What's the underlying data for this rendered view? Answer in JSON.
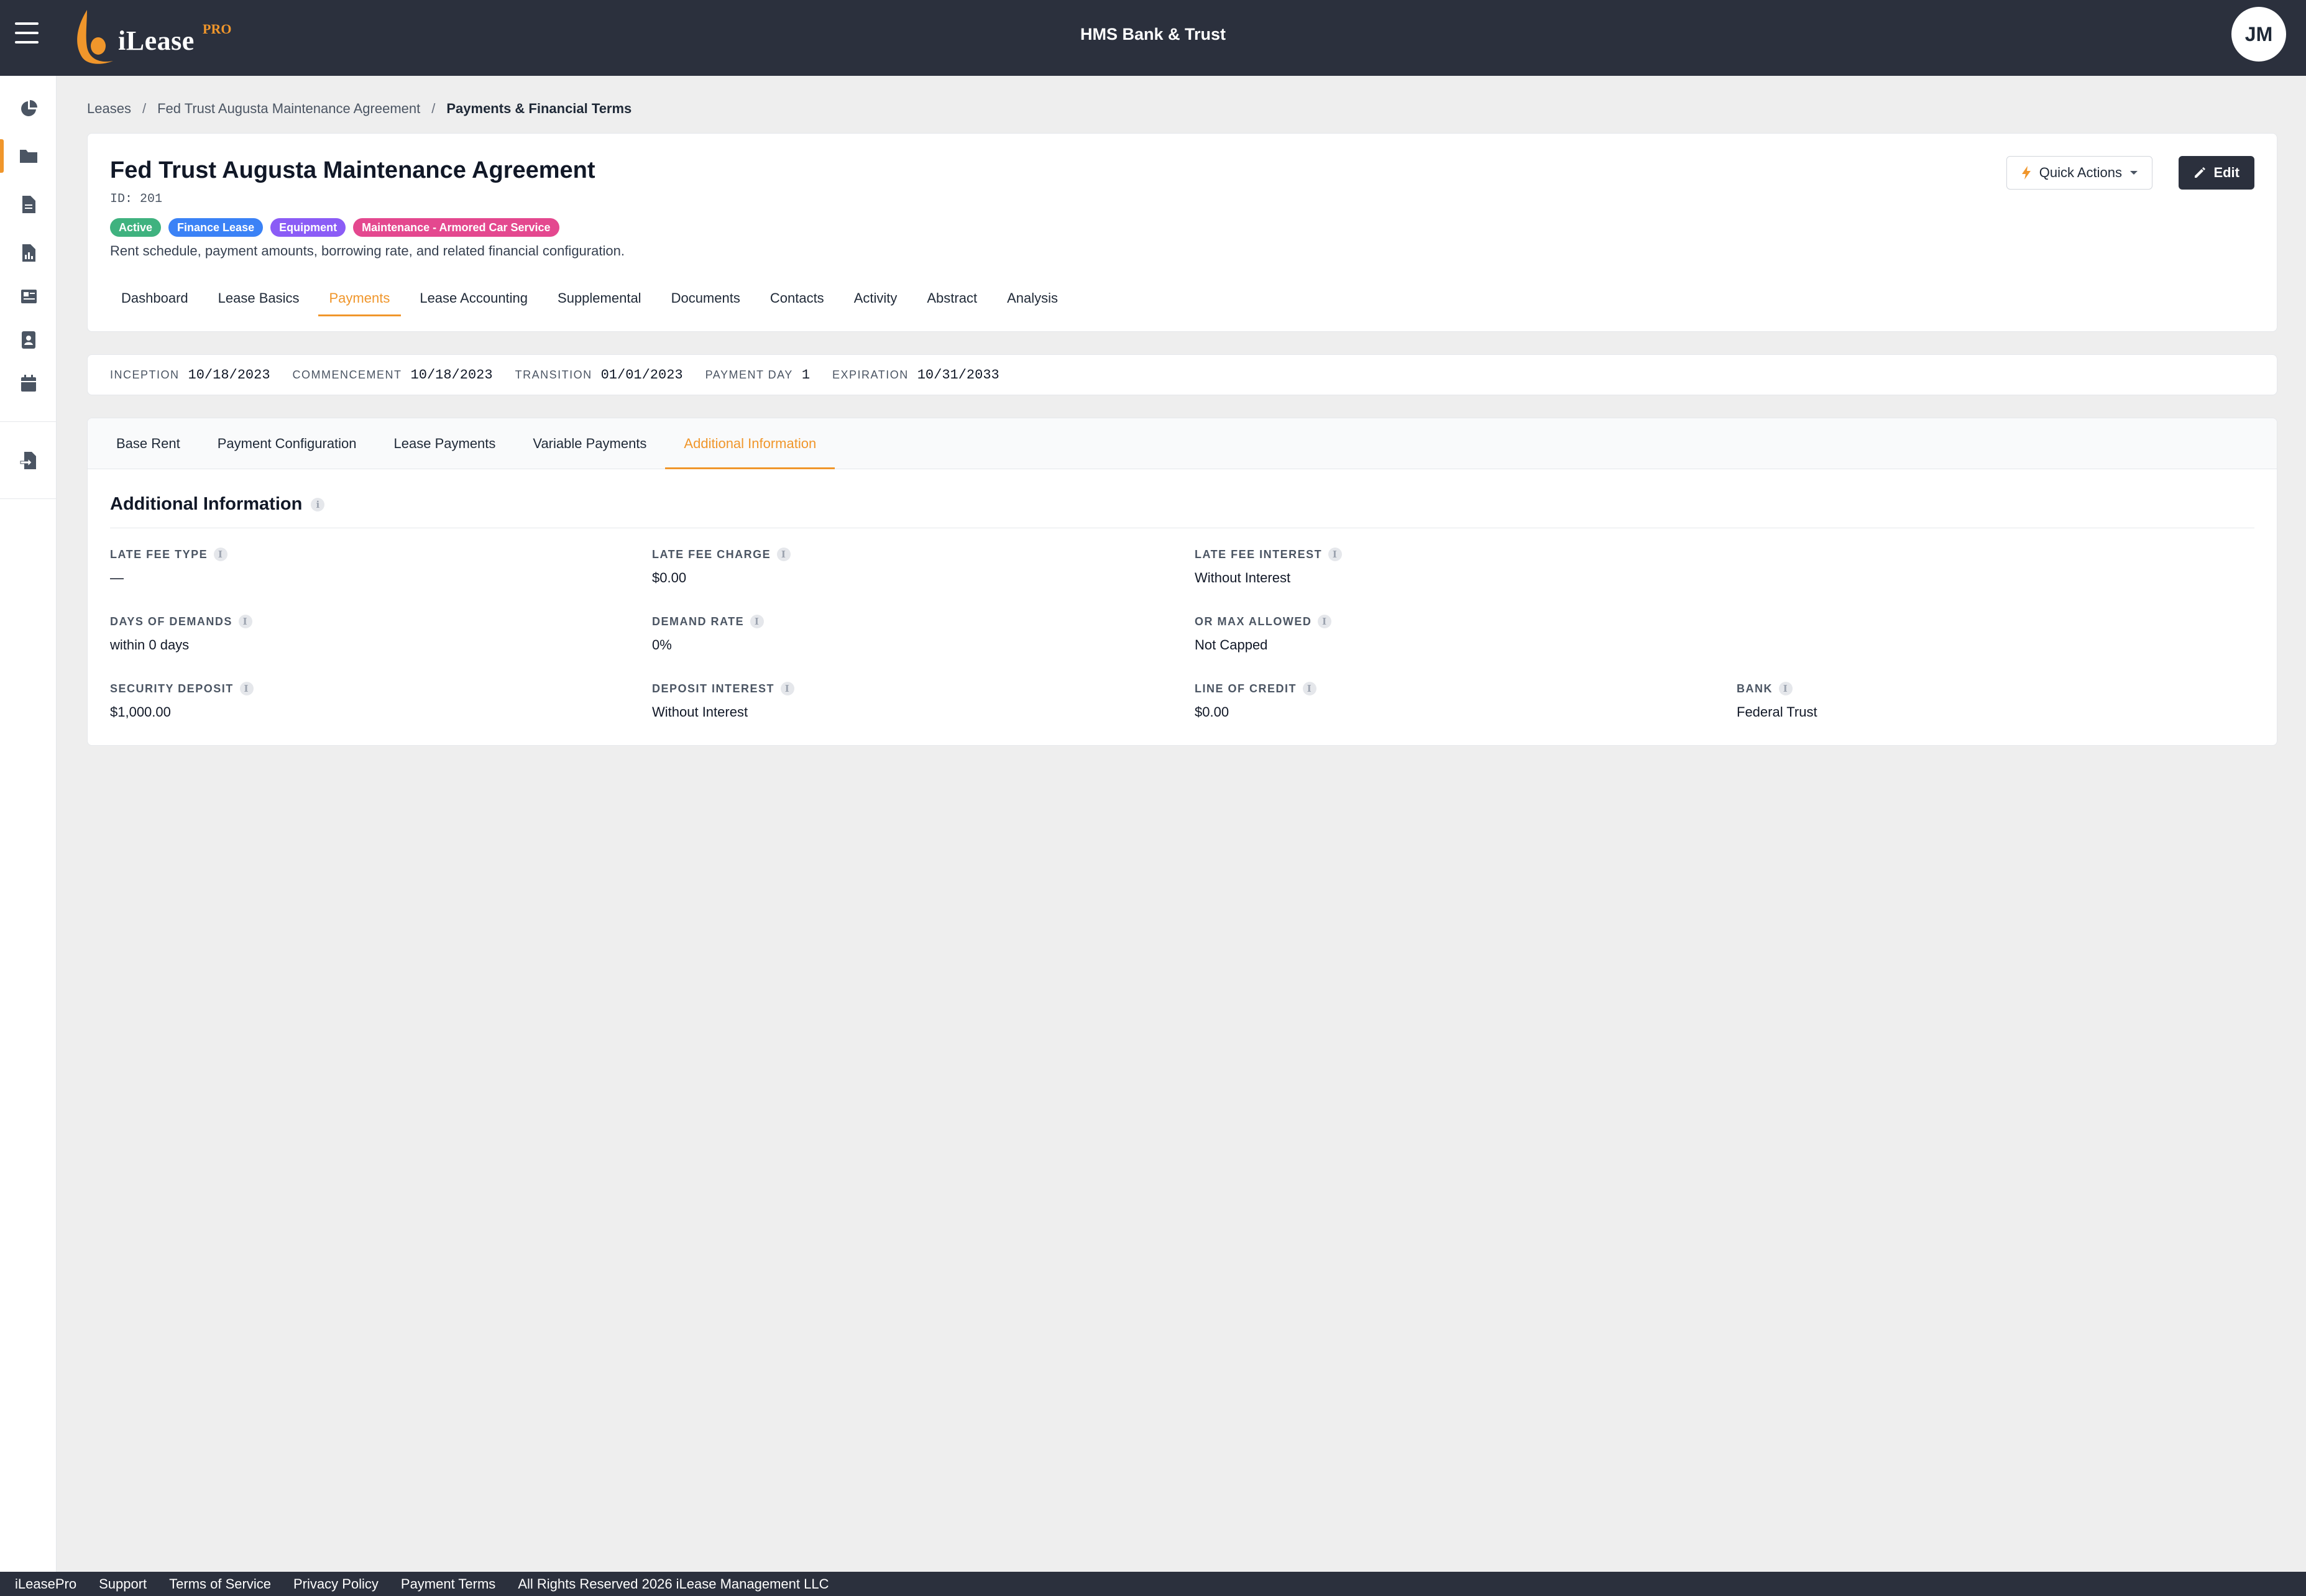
{
  "app": {
    "logo_text": "iLease",
    "logo_badge": "PRO",
    "org_name": "HMS Bank & Trust",
    "user_initials": "JM"
  },
  "colors": {
    "topbar": "#2b303d",
    "accent": "#f0962b",
    "badge_active": "#3fb27f",
    "badge_finance": "#3b82f6",
    "badge_equipment": "#8b5cf6",
    "badge_maintenance": "#e4488f"
  },
  "rail": {
    "items": [
      {
        "icon": "pie-chart-icon"
      },
      {
        "icon": "folder-icon"
      },
      {
        "icon": "document-icon"
      },
      {
        "icon": "report-icon"
      },
      {
        "icon": "newspaper-icon"
      },
      {
        "icon": "contact-card-icon"
      },
      {
        "icon": "calendar-icon"
      },
      {
        "icon": "file-import-icon"
      }
    ]
  },
  "breadcrumb": {
    "items": [
      "Leases",
      "Fed Trust Augusta Maintenance Agreement"
    ],
    "current": "Payments & Financial Terms",
    "separator": "/"
  },
  "lease": {
    "title": "Fed Trust Augusta Maintenance Agreement",
    "id_text": "ID: 201",
    "badges": [
      "Active",
      "Finance Lease",
      "Equipment",
      "Maintenance - Armored Car Service"
    ],
    "description": "Rent schedule, payment amounts, borrowing rate, and related financial configuration."
  },
  "actions": {
    "quick_actions": "Quick Actions",
    "edit": "Edit"
  },
  "main_tabs": [
    "Dashboard",
    "Lease Basics",
    "Payments",
    "Lease Accounting",
    "Supplemental",
    "Documents",
    "Contacts",
    "Activity",
    "Abstract",
    "Analysis"
  ],
  "main_tab_active": "Payments",
  "dates": [
    {
      "label": "Inception",
      "value": "10/18/2023"
    },
    {
      "label": "Commencement",
      "value": "10/18/2023"
    },
    {
      "label": "Transition",
      "value": "01/01/2023"
    },
    {
      "label": "Payment Day",
      "value": "1"
    },
    {
      "label": "Expiration",
      "value": "10/31/2033"
    }
  ],
  "sub_tabs": [
    "Base Rent",
    "Payment Configuration",
    "Lease Payments",
    "Variable Payments",
    "Additional Information"
  ],
  "sub_tab_active": "Additional Information",
  "additional": {
    "title": "Additional Information",
    "fields": [
      {
        "label": "Late Fee Type",
        "value": "—"
      },
      {
        "label": "Late Fee Charge",
        "value": "$0.00"
      },
      {
        "label": "Late Fee Interest",
        "value": "Without Interest"
      },
      {
        "label": "Days of Demands",
        "value": "within 0 days"
      },
      {
        "label": "Demand Rate",
        "value": "0%"
      },
      {
        "label": "Or Max Allowed",
        "value": "Not Capped"
      },
      {
        "label": "Security Deposit",
        "value": "$1,000.00"
      },
      {
        "label": "Deposit Interest",
        "value": "Without Interest"
      },
      {
        "label": "Line of Credit",
        "value": "$0.00"
      },
      {
        "label": "Bank",
        "value": "Federal Trust"
      }
    ]
  },
  "footer": {
    "items": [
      "iLeasePro",
      "Support",
      "Terms of Service",
      "Privacy Policy",
      "Payment Terms",
      "All Rights Reserved 2026 iLease Management LLC"
    ]
  }
}
